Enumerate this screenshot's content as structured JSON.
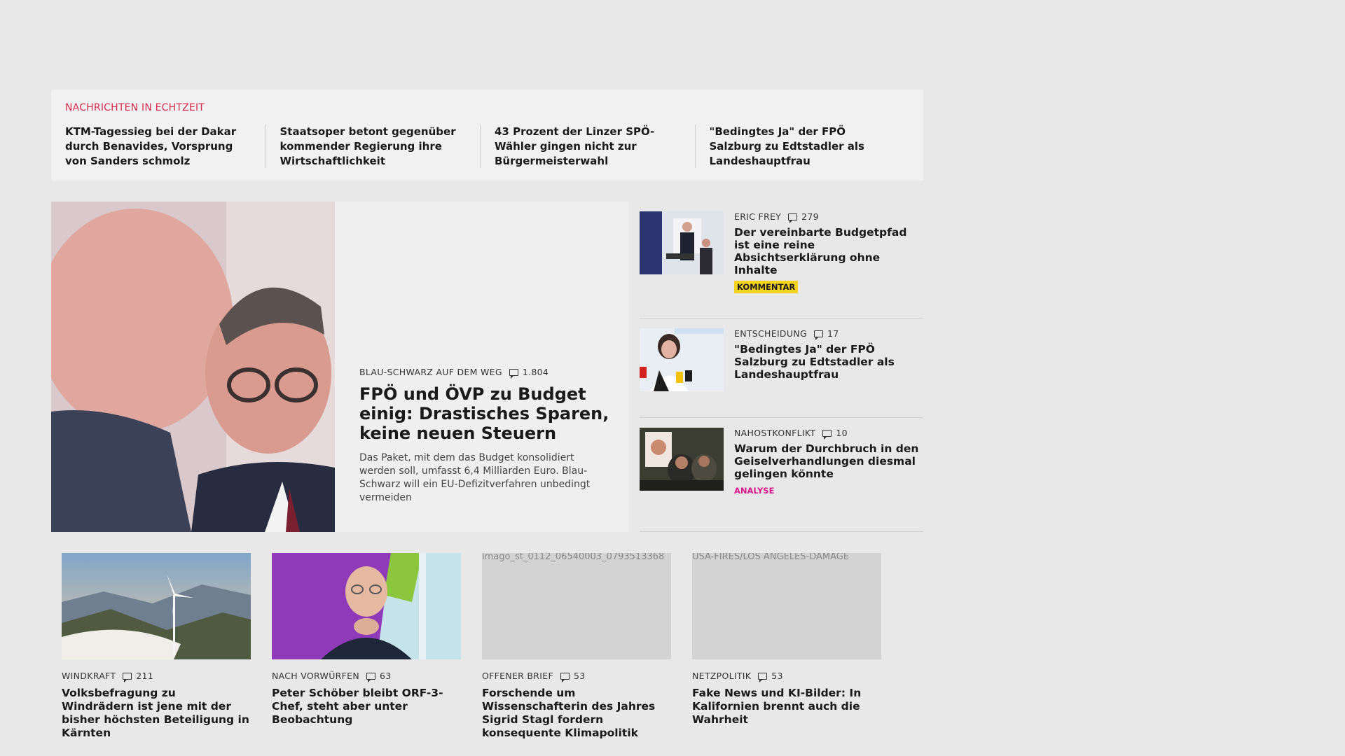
{
  "ticker": {
    "heading": "NACHRICHTEN IN ECHTZEIT",
    "items": [
      "KTM-Tagessieg bei der Dakar durch Benavides, Vorsprung von Sanders schmolz",
      "Staatsoper betont gegenüber kom­mender Regierung ihre Wirtschaftlichkeit",
      "43 Prozent der Linzer SPÖ-Wähler gingen nicht zur Bürgermeisterwahl",
      "\"Bedingtes Ja\" der FPÖ Salzburg zu Edtstadler als Landeshauptfrau"
    ]
  },
  "hero": {
    "kicker": "BLAU-SCHWARZ AUF DEM WEG",
    "comments": "1.804",
    "title": "FPÖ und ÖVP zu Budget einig: Drastisches Sparen, keine neuen Steuern",
    "teaser": "Das Paket, mit dem das Budget konsolidiert werden soll, umfasst 6,4 Milliarden Euro. Blau-Schwarz will ein EU-Defizitverfahren unbedingt vermeiden"
  },
  "side": [
    {
      "kicker": "ERIC FREY",
      "comments": "279",
      "title": "Der vereinbarte Budgetpfad ist eine reine Absichtserklärung ohne Inhalte",
      "badge": "KOMMENTAR"
    },
    {
      "kicker": "ENTSCHEIDUNG",
      "comments": "17",
      "title": "\"Bedingtes Ja\" der FPÖ Salzburg zu Edtstadler als Landeshaupt­frau",
      "badge": ""
    },
    {
      "kicker": "NAHOSTKONFLIKT",
      "comments": "10",
      "title": "Warum der Durchbruch in den Geiselverhandlungen diesmal gelingen könnte",
      "badge": "ANALYSE"
    }
  ],
  "cards": [
    {
      "kicker": "WINDKRAFT",
      "comments": "211",
      "title": "Volksbefragung zu Windrädern ist jene mit der bisher höchsten Beteiligung in Kärnten",
      "alt": ""
    },
    {
      "kicker": "NACH VORWÜRFEN",
      "comments": "63",
      "title": "Peter Schöber bleibt ORF-3-Chef, steht aber unter Beobachtung",
      "alt": ""
    },
    {
      "kicker": "OFFENER BRIEF",
      "comments": "53",
      "title": "Forschende um Wissenschafterin des Jahres Sigrid Stagl fordern konsequente Klimapolitik",
      "alt": "imago_st_0112_06540003_0793513368"
    },
    {
      "kicker": "NETZPOLITIK",
      "comments": "53",
      "title": "Fake News und KI-Bilder: In Kalifornien brennt auch die Wahrheit",
      "alt": "USA-FIRES/LOS ANGELES-DAMAGE"
    }
  ],
  "colors": {
    "ticker_accent": "#d62a4e",
    "badge_kommentar": "#f5d31f",
    "badge_analyse": "#d6188c"
  }
}
